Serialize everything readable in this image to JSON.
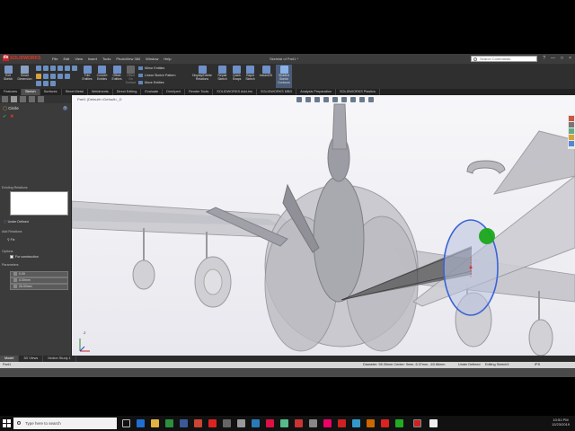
{
  "app": {
    "brand": "SOLIDWORKS",
    "document_title": "Skeletal of Part1 *",
    "menu": [
      "File",
      "Edit",
      "View",
      "Insert",
      "Tools",
      "PhotoView 360",
      "Window",
      "Help"
    ],
    "search_placeholder": "Search Commands",
    "window_controls": [
      "?",
      "—",
      "□",
      "×"
    ]
  },
  "command_manager": {
    "exit_sketch": "Exit\nSketch",
    "smart_dimension": "Smart\nDimension",
    "trim_entities": "Trim\nEntities",
    "convert_entities": "Convert\nEntities",
    "offset_entities": "Offset\nEntities",
    "offset_on_surface": "Offset\nOn\nSurface",
    "mirror_entities": "Mirror Entities",
    "linear_sketch_pattern": "Linear Sketch Pattern",
    "move_entities": "Move Entities",
    "display_delete_relations": "Display/Delete\nRelations",
    "repair_sketch": "Repair\nSketch",
    "quick_snaps": "Quick\nSnaps",
    "rapid_sketch": "Rapid\nSketch",
    "instant2d": "Instant2D",
    "shaded_sketch_contours": "Shaded\nSketch\nContours"
  },
  "tabs": [
    "Features",
    "Sketch",
    "Surfaces",
    "Sheet Metal",
    "Weldments",
    "Direct Editing",
    "Evaluate",
    "DimXpert",
    "Render Tools",
    "SOLIDWORKS Add-Ins",
    "SOLIDWORKS MBD",
    "Analysis Preparation",
    "SOLIDWORKS Plastics"
  ],
  "active_tab": "Sketch",
  "property_manager": {
    "title": "Circle",
    "help": "?",
    "ok_cancel": [
      "✔",
      "✖"
    ],
    "existing_relations": "Existing Relations",
    "under_defined": "Under Defined",
    "add_relations": "Add Relations",
    "fix": "Fix",
    "options": "Options",
    "for_construction": "For construction",
    "parameters": "Parameters",
    "fields": [
      "0.00",
      "0.00mm",
      "26.00mm"
    ]
  },
  "viewport": {
    "breadcrumb": "Part1 (Default<<Default>_D",
    "triad": "Z"
  },
  "document_tabs": [
    "Model",
    "3D Views",
    "Motion Study 1"
  ],
  "active_document_tab": "Model",
  "status_bar": {
    "part": "Part1",
    "diameter": "Diameter: 55.39mm  Center: 9mm, 6.37mm, -63.66mm",
    "state": "Under Defined",
    "editing": "Editing Sketch3",
    "units": "IPS"
  },
  "taskbar": {
    "search_placeholder": "Type here to search",
    "time": "10:51 PM",
    "date": "12/23/2019"
  },
  "colors": {
    "accent_red": "#c8102e",
    "selection_blue": "#3a62d6",
    "highlight_green": "#1aa81a"
  }
}
